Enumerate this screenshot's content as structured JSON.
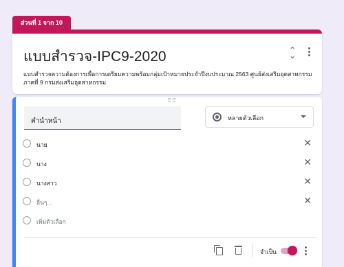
{
  "section": {
    "label": "ส่วนที่ 1 จาก 10"
  },
  "form": {
    "title": "แบบสำรวจ-IPC9-2020",
    "description": "แบบสำรวจความต้องการเพื่อการเตรียมความพร้อมกลุ่มเป้าหมายประจำปีงบประมาณ 2563 ศูนย์ส่งเสริมอุตสาหกรรมภาคที่ 9 กรมส่งเสริมอุตสาหกรรม"
  },
  "question": {
    "title": "คำนำหน้า",
    "type_label": "หลายตัวเลือก",
    "options": [
      "นาย",
      "นาง",
      "นางสาว",
      "อื่นๆ..."
    ],
    "add_option": "เพิ่มตัวเลือก",
    "required_label": "จำเป็น",
    "required": true
  },
  "colors": {
    "accent": "#c2185b",
    "focus": "#4285f4",
    "background": "#f0ebf8"
  },
  "icons": [
    "collapse-icon",
    "more-icon",
    "radio-icon",
    "dropdown-icon",
    "close-icon",
    "copy-icon",
    "trash-icon",
    "toggle",
    "drag-handle-icon"
  ]
}
